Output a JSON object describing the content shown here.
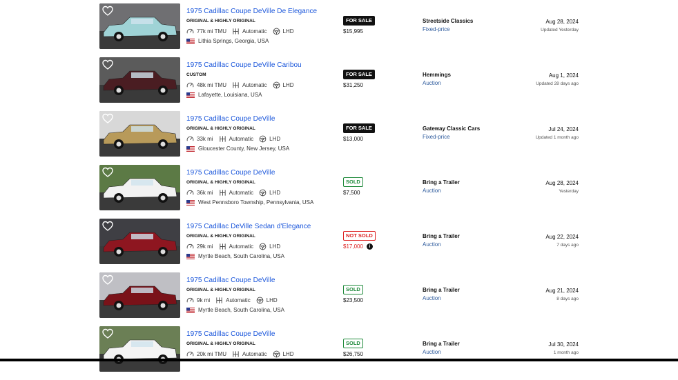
{
  "colors": {
    "link": "#1a56db",
    "sold_green": "#1f8a3b",
    "not_sold_red": "#d22222",
    "sale_black": "#111111"
  },
  "icons": {
    "favorite": "heart-icon",
    "mileage": "speedometer-icon",
    "transmission": "gearbox-icon",
    "steering": "steering-wheel-icon",
    "country": "us-flag-icon",
    "price_info": "info-icon"
  },
  "listings": [
    {
      "title": "1975 Cadillac Coupe DeVille De Elegance",
      "condition": "ORIGINAL & HIGHLY ORIGINAL",
      "mileage": "77k mi TMU",
      "transmission": "Automatic",
      "drive": "LHD",
      "location": "Lithia Springs, Georgia, USA",
      "status": "FOR SALE",
      "status_kind": "sale",
      "price": "$15,995",
      "seller": "Streetside Classics",
      "sale_type": "Fixed-price",
      "date": "Aug 28, 2024",
      "updated": "Updated Yesterday",
      "car_color": "#9fd3d6"
    },
    {
      "title": "1975 Cadillac Coupe DeVille Caribou",
      "condition": "CUSTOM",
      "mileage": "48k mi TMU",
      "transmission": "Automatic",
      "drive": "LHD",
      "location": "Lafayette, Louisiana, USA",
      "status": "FOR SALE",
      "status_kind": "sale",
      "price": "$31,250",
      "seller": "Hemmings",
      "sale_type": "Auction",
      "date": "Aug 1, 2024",
      "updated": "Updated 28 days ago",
      "car_color": "#4a1d22"
    },
    {
      "title": "1975 Cadillac Coupe DeVille",
      "condition": "ORIGINAL & HIGHLY ORIGINAL",
      "mileage": "33k mi",
      "transmission": "Automatic",
      "drive": "LHD",
      "location": "Gloucester County, New Jersey, USA",
      "status": "FOR SALE",
      "status_kind": "sale",
      "price": "$13,000",
      "seller": "Gateway Classic Cars",
      "sale_type": "Fixed-price",
      "date": "Jul 24, 2024",
      "updated": "Updated 1 month ago",
      "car_color": "#b89a5a"
    },
    {
      "title": "1975 Cadillac Coupe DeVille",
      "condition": "ORIGINAL & HIGHLY ORIGINAL",
      "mileage": "36k mi",
      "transmission": "Automatic",
      "drive": "LHD",
      "location": "West Pennsboro Township, Pennsylvania, USA",
      "status": "SOLD",
      "status_kind": "sold",
      "price": "$7,500",
      "seller": "Bring a Trailer",
      "sale_type": "Auction",
      "date": "Aug 28, 2024",
      "updated": "Yesterday",
      "car_color": "#f2f2f2"
    },
    {
      "title": "1975 Cadillac DeVille Sedan d'Elegance",
      "condition": "ORIGINAL & HIGHLY ORIGINAL",
      "mileage": "29k mi",
      "transmission": "Automatic",
      "drive": "LHD",
      "location": "Myrtle Beach, South Carolina, USA",
      "status": "NOT SOLD",
      "status_kind": "notsold",
      "price": "$17,000",
      "seller": "Bring a Trailer",
      "sale_type": "Auction",
      "date": "Aug 22, 2024",
      "updated": "7 days ago",
      "car_color": "#8e1620"
    },
    {
      "title": "1975 Cadillac Coupe DeVille",
      "condition": "ORIGINAL & HIGHLY ORIGINAL",
      "mileage": "9k mi",
      "transmission": "Automatic",
      "drive": "LHD",
      "location": "Myrtle Beach, South Carolina, USA",
      "status": "SOLD",
      "status_kind": "sold",
      "price": "$23,500",
      "seller": "Bring a Trailer",
      "sale_type": "Auction",
      "date": "Aug 21, 2024",
      "updated": "8 days ago",
      "car_color": "#7a1219"
    },
    {
      "title": "1975 Cadillac Coupe DeVille",
      "condition": "ORIGINAL & HIGHLY ORIGINAL",
      "mileage": "20k mi TMU",
      "transmission": "Automatic",
      "drive": "LHD",
      "location": "",
      "status": "SOLD",
      "status_kind": "sold",
      "price": "$26,750",
      "seller": "Bring a Trailer",
      "sale_type": "Auction",
      "date": "Jul 30, 2024",
      "updated": "1 month ago",
      "car_color": "#f4f4f4"
    }
  ]
}
